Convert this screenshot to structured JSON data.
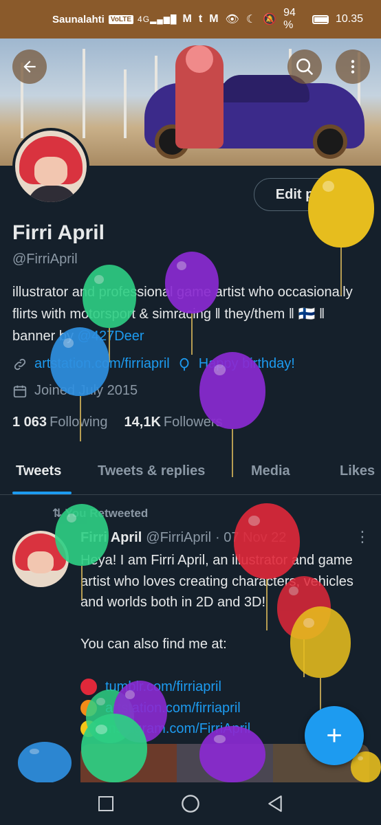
{
  "status_bar": {
    "carrier": "Saunalahti",
    "volte": "VoLTE",
    "signal": "4G",
    "app_icons": [
      "gmail-icon",
      "tumblr-icon",
      "gmail-icon"
    ],
    "status_icons": [
      "eye-icon",
      "moon-icon",
      "mute-icon"
    ],
    "battery": "94 %",
    "time": "10.35"
  },
  "header": {
    "back_icon": "arrow-left-icon",
    "search_icon": "search-icon",
    "menu_icon": "more-vertical-icon"
  },
  "profile": {
    "edit_label": "Edit profile",
    "name": "Firri April",
    "handle": "@FirriApril",
    "bio_text": "illustrator and professional game artist who occasionally flirts with motorsport & simracing ‖ they/them ‖ 🇫🇮 ‖ banner by ",
    "bio_link": "@427Deer",
    "website": "artstation.com/firriapril",
    "birthday": "Happy birthday!",
    "joined": "Joined July 2015",
    "following_count": "1 063",
    "following_label": "Following",
    "followers_count": "14,1K",
    "followers_label": "Followers"
  },
  "tabs": [
    {
      "label": "Tweets"
    },
    {
      "label": "Tweets & replies"
    },
    {
      "label": "Media"
    },
    {
      "label": "Likes"
    }
  ],
  "tweet": {
    "retweet_label": "You Retweeted",
    "name": "Firri April",
    "handle": "@FirriApril",
    "date": "· 07 Nov 22",
    "body": "Heya! I am Firri April, an illustrator and game artist who loves creating characters, vehicles and worlds both in 2D and 3D!",
    "body2": "You can also find me at:",
    "links": [
      {
        "text": "tumblr.com/firriapril",
        "color": "#e0283a"
      },
      {
        "text": "artstation.com/firriapril",
        "color": "#f28c18"
      },
      {
        "text": "instagram.com/FirriApril",
        "color": "#f5c518"
      }
    ]
  },
  "fab_label": "+",
  "colors": {
    "background": "#15202b",
    "accent": "#1d9bf0",
    "muted": "#8b98a5",
    "status_bar": "#8a5a2b"
  }
}
